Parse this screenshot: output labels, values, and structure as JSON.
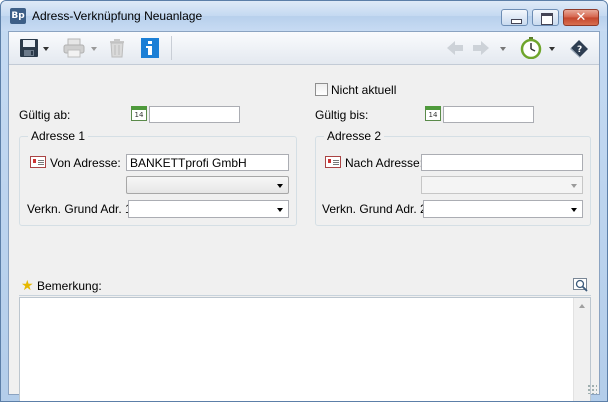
{
  "window": {
    "title": "Adress-Verknüpfung Neuanlage",
    "app_icon_text": "Bp"
  },
  "toolbar": {
    "icons": [
      "save-icon",
      "print-icon",
      "delete-icon",
      "info-icon",
      "back-arrow-icon",
      "forward-arrow-icon",
      "timer-icon",
      "help-book-icon"
    ]
  },
  "form": {
    "not_current_label": "Nicht aktuell",
    "not_current_checked": false,
    "valid_from_label": "Gültig ab:",
    "valid_from_value": "",
    "valid_to_label": "Gültig bis:",
    "valid_to_value": "",
    "calendar_day": "14",
    "address1": {
      "title": "Adresse 1",
      "from_label": "Von Adresse:",
      "from_value": "BANKETTprofi GmbH",
      "combo_value": "",
      "reason_label": "Verkn. Grund Adr. 1:",
      "reason_value": ""
    },
    "address2": {
      "title": "Adresse 2",
      "to_label": "Nach Adresse:",
      "to_value": "",
      "combo_value": "",
      "reason_label": "Verkn. Grund Adr. 2:",
      "reason_value": ""
    },
    "remark": {
      "label": "Bemerkung:",
      "value": ""
    }
  },
  "colors": {
    "info_blue": "#1b7fd6",
    "calendar_green": "#4e9a3b",
    "close_red": "#c4452c"
  }
}
